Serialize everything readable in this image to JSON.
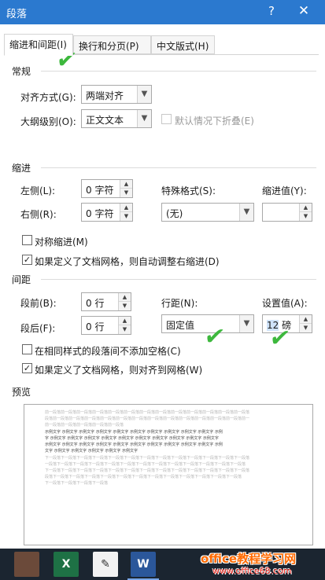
{
  "window": {
    "title": "段落",
    "help": "?",
    "close": "✕"
  },
  "tabs": [
    {
      "label": "缩进和间距(I)"
    },
    {
      "label": "换行和分页(P)"
    },
    {
      "label": "中文版式(H)"
    }
  ],
  "general": {
    "heading": "常规",
    "alignment_label": "对齐方式(G):",
    "alignment_value": "两端对齐",
    "outline_label": "大纲级别(O):",
    "outline_value": "正文文本",
    "collapse_label": "默认情况下折叠(E)"
  },
  "indent": {
    "heading": "缩进",
    "left_label": "左侧(L):",
    "left_value": "0 字符",
    "right_label": "右侧(R):",
    "right_value": "0 字符",
    "special_label": "特殊格式(S):",
    "special_value": "(无)",
    "by_label": "缩进值(Y):",
    "by_value": "",
    "mirror_label": "对称缩进(M)",
    "auto_adjust_label": "如果定义了文档网格，则自动调整右缩进(D)"
  },
  "spacing": {
    "heading": "间距",
    "before_label": "段前(B):",
    "before_value": "0 行",
    "after_label": "段后(F):",
    "after_value": "0 行",
    "line_label": "行距(N):",
    "line_value": "固定值",
    "at_label": "设置值(A):",
    "at_value_num": "12",
    "at_value_unit": " 磅",
    "no_space_label": "在相同样式的段落间不添加空格(C)",
    "snap_grid_label": "如果定义了文档网格，则对齐到网格(W)"
  },
  "preview": {
    "heading": "预览",
    "prev_lines": [
      "前一段落前一段落前一段落前一段落前一段落前一段落前一段落前一段落前一段落前一段落前一段落前一段落前一段落",
      "段落前一段落前一段落前一段落前一段落前一段落前一段落前一段落前一段落前一段落前一段落前一段落前一段落前一",
      "前一段落前一段落前一段落前一段落前一段落"
    ],
    "sample_lines": [
      "示例文字 示例文字 示例文字 示例文字 示例文字 示例文字 示例文字 示例文字 示例文字 示例文字 示例",
      "字 示例文字 示例文字 示例文字 示例文字 示例文字 示例文字 示例文字 示例文字 示例文字 示例文字",
      "示例文字 示例文字 示例文字 示例文字 示例文字 示例文字 示例文字 示例文字 示例文字 示例文字 示例",
      "文字 示例文字 示例文字 示例文字 示例文字 示例文字"
    ],
    "next_lines": [
      "下一段落下一段落下一段落下一段落下一段落下一段落下一段落下一段落下一段落下一段落下一段落下一段落下一段落",
      "一段落下一段落下一段落下一段落下一段落下一段落下一段落下一段落下一段落下一段落下一段落下一段落下一段落",
      "下一段落下一段落下一段落下一段落下一段落下一段落下一段落下一段落下一段落下一段落下一段落下一段落下一段落",
      "段落下一段落下一段落下一段落下一段落下一段落下一段落下一段落下一段落下一段落下一段落下一段落下一段落",
      "下一段落下一段落下一段落下一段落"
    ]
  },
  "taskbar": {
    "excel_glyph": "X",
    "word_glyph": "W"
  },
  "watermark": {
    "line1": "office教程学习网",
    "line2": "www.office68.com"
  }
}
